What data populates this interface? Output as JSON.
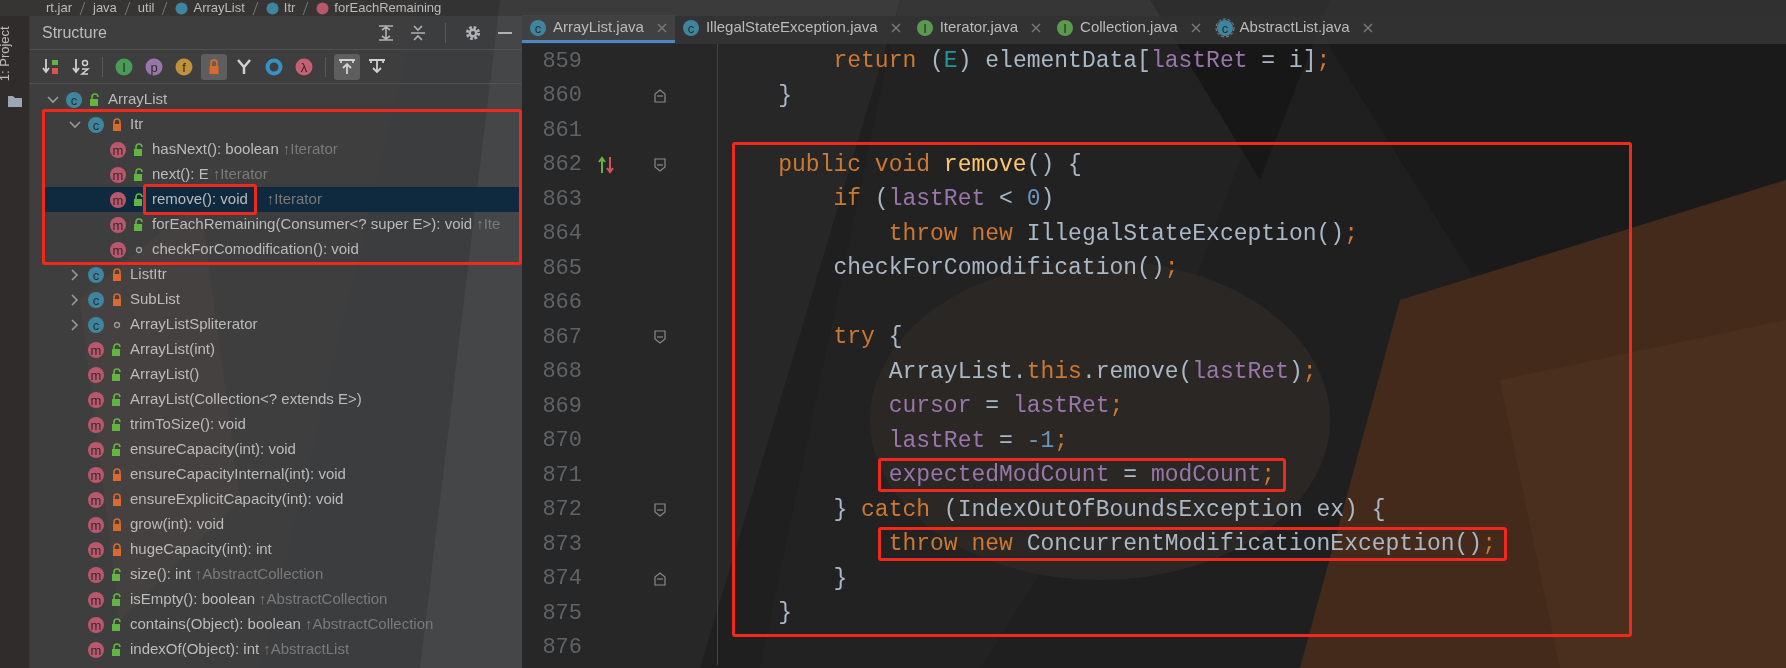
{
  "breadcrumb": [
    {
      "label": "rt.jar"
    },
    {
      "label": "java"
    },
    {
      "label": "util"
    },
    {
      "label": "ArrayList",
      "kind": "class"
    },
    {
      "label": "Itr",
      "kind": "class"
    },
    {
      "label": "forEachRemaining",
      "kind": "method"
    }
  ],
  "side_stripe": {
    "label": "1: Project"
  },
  "structure": {
    "title": "Structure",
    "header_tools": [
      {
        "kind": "expand"
      },
      {
        "kind": "collapse"
      },
      {
        "kind": "settings"
      },
      {
        "kind": "minimize"
      }
    ],
    "toolbar": [
      {
        "kind": "sortvisibility",
        "on": false
      },
      {
        "kind": "sortalpha",
        "on": false
      },
      {
        "kind": "letter",
        "glyph": "I",
        "color": "#499c54",
        "on": false
      },
      {
        "kind": "letter",
        "glyph": "p",
        "color": "#9876aa",
        "on": false
      },
      {
        "kind": "letter",
        "glyph": "f",
        "color": "#c0913a",
        "on": false
      },
      {
        "kind": "lock",
        "on": true
      },
      {
        "kind": "fork",
        "on": false
      },
      {
        "kind": "ring",
        "color": "#3592c4",
        "on": false
      },
      {
        "kind": "letter",
        "glyph": "λ",
        "color": "#c75f74",
        "on": false
      },
      {
        "kind": "scrollto",
        "on": true
      },
      {
        "kind": "scrollfrom",
        "on": false
      }
    ],
    "tree": [
      {
        "label": "ArrayList",
        "kind": "class",
        "glyph": "c",
        "locked": false,
        "package_private": false,
        "expanded": true,
        "selected": false,
        "children": [
          {
            "label": "Itr",
            "kind": "class",
            "glyph": "c",
            "locked": true,
            "package_private": false,
            "expanded": true,
            "selected": false,
            "framed": true,
            "children": [
              {
                "label": "hasNext(): boolean",
                "inherited": "↑Iterator",
                "kind": "method",
                "glyph": "m",
                "locked": false,
                "package_private": false,
                "selected": false
              },
              {
                "label": "next(): E",
                "inherited": "↑Iterator",
                "kind": "method",
                "glyph": "m",
                "locked": false,
                "package_private": false,
                "selected": false
              },
              {
                "label": "remove(): void",
                "inherited": "↑Iterator",
                "kind": "method",
                "glyph": "m",
                "locked": false,
                "package_private": false,
                "selected": true,
                "boxed": true
              },
              {
                "label": "forEachRemaining(Consumer<? super E>): void",
                "inherited": "↑Ite",
                "kind": "method",
                "glyph": "m",
                "locked": false,
                "package_private": false,
                "selected": false
              },
              {
                "label": "checkForComodification(): void",
                "kind": "method",
                "glyph": "m",
                "locked": false,
                "package_private": true,
                "selected": false
              }
            ]
          },
          {
            "label": "ListItr",
            "kind": "class",
            "glyph": "c",
            "locked": true,
            "package_private": false,
            "expanded": false,
            "selected": false
          },
          {
            "label": "SubList",
            "kind": "class",
            "glyph": "c",
            "locked": true,
            "package_private": false,
            "expanded": false,
            "selected": false
          },
          {
            "label": "ArrayListSpliterator",
            "kind": "class",
            "glyph": "c",
            "locked": false,
            "package_private": true,
            "expanded": false,
            "selected": false
          },
          {
            "label": "ArrayList(int)",
            "kind": "method",
            "glyph": "m",
            "locked": false,
            "package_private": false,
            "selected": false
          },
          {
            "label": "ArrayList()",
            "kind": "method",
            "glyph": "m",
            "locked": false,
            "package_private": false,
            "selected": false
          },
          {
            "label": "ArrayList(Collection<? extends E>)",
            "kind": "method",
            "glyph": "m",
            "locked": false,
            "package_private": false,
            "selected": false
          },
          {
            "label": "trimToSize(): void",
            "kind": "method",
            "glyph": "m",
            "locked": false,
            "package_private": false,
            "selected": false
          },
          {
            "label": "ensureCapacity(int): void",
            "kind": "method",
            "glyph": "m",
            "locked": false,
            "package_private": false,
            "selected": false
          },
          {
            "label": "ensureCapacityInternal(int): void",
            "kind": "method",
            "glyph": "m",
            "locked": true,
            "package_private": false,
            "selected": false
          },
          {
            "label": "ensureExplicitCapacity(int): void",
            "kind": "method",
            "glyph": "m",
            "locked": true,
            "package_private": false,
            "selected": false
          },
          {
            "label": "grow(int): void",
            "kind": "method",
            "glyph": "m",
            "locked": true,
            "package_private": false,
            "selected": false
          },
          {
            "label": "hugeCapacity(int): int",
            "kind": "method",
            "glyph": "m",
            "locked": true,
            "package_private": false,
            "selected": false
          },
          {
            "label": "size(): int",
            "inherited": "↑AbstractCollection",
            "kind": "method",
            "glyph": "m",
            "locked": false,
            "package_private": false,
            "selected": false
          },
          {
            "label": "isEmpty(): boolean",
            "inherited": "↑AbstractCollection",
            "kind": "method",
            "glyph": "m",
            "locked": false,
            "package_private": false,
            "selected": false
          },
          {
            "label": "contains(Object): boolean",
            "inherited": "↑AbstractCollection",
            "kind": "method",
            "glyph": "m",
            "locked": false,
            "package_private": false,
            "selected": false
          },
          {
            "label": "indexOf(Object): int",
            "inherited": "↑AbstractList",
            "kind": "method",
            "glyph": "m",
            "locked": false,
            "package_private": false,
            "selected": false
          }
        ]
      }
    ]
  },
  "tabs": [
    {
      "label": "ArrayList.java",
      "kind": "class",
      "glyph": "c",
      "selected": true
    },
    {
      "label": "IllegalStateException.java",
      "kind": "class",
      "glyph": "c",
      "selected": false
    },
    {
      "label": "Iterator.java",
      "kind": "interface",
      "glyph": "I",
      "selected": false
    },
    {
      "label": "Collection.java",
      "kind": "interface",
      "glyph": "I",
      "selected": false
    },
    {
      "label": "AbstractList.java",
      "kind": "abstract",
      "glyph": "c",
      "selected": false
    }
  ],
  "code": {
    "blocks": [
      {
        "framed": false,
        "lines": [
          {
            "number": "859",
            "fold_start": false,
            "fold_end": false,
            "implemented": false,
            "boxed": false,
            "tokens": [
              {
                "text": "        return",
                "kind": "keyword"
              },
              {
                "text": " (",
                "kind": "plain"
              },
              {
                "text": "E",
                "kind": "typeparam"
              },
              {
                "text": ") elementData[",
                "kind": "plain"
              },
              {
                "text": "lastRet",
                "kind": "field"
              },
              {
                "text": " = i]",
                "kind": "plain"
              },
              {
                "text": ";",
                "kind": "punct"
              }
            ]
          },
          {
            "number": "860",
            "fold_start": false,
            "fold_end": true,
            "implemented": false,
            "boxed": false,
            "tokens": [
              {
                "text": "    }",
                "kind": "plain"
              }
            ]
          },
          {
            "number": "861",
            "fold_start": false,
            "fold_end": false,
            "implemented": false
          }
        ]
      },
      {
        "framed": true,
        "lines": [
          {
            "number": "862",
            "fold_start": true,
            "fold_end": false,
            "implemented": true,
            "boxed": false,
            "tokens": [
              {
                "text": "    public void ",
                "kind": "keyword"
              },
              {
                "text": "remove",
                "kind": "method"
              },
              {
                "text": "() {",
                "kind": "plain"
              }
            ]
          },
          {
            "number": "863",
            "fold_start": false,
            "fold_end": false,
            "implemented": false,
            "boxed": false,
            "tokens": [
              {
                "text": "        if",
                "kind": "keyword"
              },
              {
                "text": " (",
                "kind": "plain"
              },
              {
                "text": "lastRet",
                "kind": "field"
              },
              {
                "text": " < ",
                "kind": "plain"
              },
              {
                "text": "0",
                "kind": "number"
              },
              {
                "text": ")",
                "kind": "plain"
              }
            ]
          },
          {
            "number": "864",
            "fold_start": false,
            "fold_end": false,
            "implemented": false,
            "boxed": false,
            "tokens": [
              {
                "text": "            throw new",
                "kind": "keyword"
              },
              {
                "text": " IllegalStateException()",
                "kind": "plain"
              },
              {
                "text": ";",
                "kind": "punct"
              }
            ]
          },
          {
            "number": "865",
            "fold_start": false,
            "fold_end": false,
            "implemented": false,
            "boxed": false,
            "tokens": [
              {
                "text": "        checkForComodification()",
                "kind": "plain"
              },
              {
                "text": ";",
                "kind": "punct"
              }
            ]
          },
          {
            "number": "866",
            "fold_start": false,
            "fold_end": false,
            "implemented": false
          },
          {
            "number": "867",
            "fold_start": true,
            "fold_end": false,
            "implemented": false,
            "boxed": false,
            "tokens": [
              {
                "text": "        try",
                "kind": "keyword"
              },
              {
                "text": " {",
                "kind": "plain"
              }
            ]
          },
          {
            "number": "868",
            "fold_start": false,
            "fold_end": false,
            "implemented": false,
            "boxed": false,
            "tokens": [
              {
                "text": "            ArrayList.",
                "kind": "plain"
              },
              {
                "text": "this",
                "kind": "keyword"
              },
              {
                "text": ".remove(",
                "kind": "plain"
              },
              {
                "text": "lastRet",
                "kind": "field"
              },
              {
                "text": ")",
                "kind": "plain"
              },
              {
                "text": ";",
                "kind": "punct"
              }
            ]
          },
          {
            "number": "869",
            "fold_start": false,
            "fold_end": false,
            "implemented": false,
            "boxed": false,
            "tokens": [
              {
                "text": "            cursor",
                "kind": "field"
              },
              {
                "text": " = ",
                "kind": "plain"
              },
              {
                "text": "lastRet",
                "kind": "field"
              },
              {
                "text": ";",
                "kind": "punct"
              }
            ]
          },
          {
            "number": "870",
            "fold_start": false,
            "fold_end": false,
            "implemented": false,
            "boxed": false,
            "tokens": [
              {
                "text": "            lastRet",
                "kind": "field"
              },
              {
                "text": " = ",
                "kind": "plain"
              },
              {
                "text": "-1",
                "kind": "number"
              },
              {
                "text": ";",
                "kind": "punct"
              }
            ]
          },
          {
            "number": "871",
            "fold_start": false,
            "fold_end": false,
            "implemented": false,
            "boxed": true,
            "tokens": [
              {
                "text": "            expectedModCount",
                "kind": "field"
              },
              {
                "text": " = ",
                "kind": "plain"
              },
              {
                "text": "modCount",
                "kind": "field"
              },
              {
                "text": ";",
                "kind": "punct"
              }
            ]
          },
          {
            "number": "872",
            "fold_start": true,
            "fold_end": false,
            "implemented": false,
            "boxed": false,
            "tokens": [
              {
                "text": "        } ",
                "kind": "plain"
              },
              {
                "text": "catch",
                "kind": "keyword"
              },
              {
                "text": " (IndexOutOfBoundsException ex) {",
                "kind": "plain"
              }
            ]
          },
          {
            "number": "873",
            "fold_start": false,
            "fold_end": false,
            "implemented": false,
            "boxed": true,
            "tokens": [
              {
                "text": "            throw new",
                "kind": "keyword"
              },
              {
                "text": " ConcurrentModificationException()",
                "kind": "plain"
              },
              {
                "text": ";",
                "kind": "punct"
              }
            ]
          },
          {
            "number": "874",
            "fold_start": false,
            "fold_end": true,
            "implemented": false,
            "boxed": false,
            "tokens": [
              {
                "text": "        }",
                "kind": "plain"
              }
            ]
          },
          {
            "number": "875",
            "fold_start": false,
            "fold_end": false,
            "implemented": false,
            "boxed": false,
            "tokens": [
              {
                "text": "    }",
                "kind": "plain"
              }
            ]
          }
        ]
      },
      {
        "framed": false,
        "lines": [
          {
            "number": "876",
            "fold_start": false,
            "fold_end": false,
            "implemented": false
          }
        ]
      }
    ]
  }
}
